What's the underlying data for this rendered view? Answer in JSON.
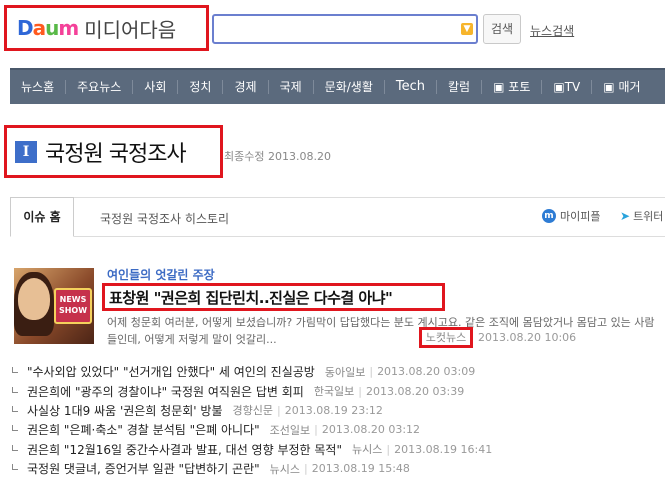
{
  "header": {
    "logo": {
      "d": "D",
      "a": "a",
      "u": "u",
      "m": "m",
      "media": "미디어다음"
    },
    "search": {
      "value": "",
      "placeholder": ""
    },
    "search_button": "검색",
    "news_search": "뉴스검색"
  },
  "nav": [
    "뉴스홈",
    "주요뉴스",
    "사회",
    "정치",
    "경제",
    "국제",
    "문화/생활",
    "Tech",
    "칼럼",
    "포토",
    "TV",
    "매거"
  ],
  "issue": {
    "icon": "I",
    "title": "국정원 국정조사",
    "meta": "최종수정 2013.08.20"
  },
  "tabs": {
    "active": "이슈 홈",
    "history": "국정원 국정조사 히스토리",
    "my_people": "마이피플",
    "twitter": "트위터"
  },
  "main_article": {
    "thumb_badge": "NEWS SHOW",
    "subheading": "여인들의 엇갈린 주장",
    "headline": "표창원 \"권은희 집단린치..진실은 다수결 아냐\"",
    "summary": "어제 청문회 여러분, 어떻게 보셨습니까? 가림막이 답답했다는 분도 계시고요. 같은 조직에 몸담았거나 몸담고 있는 사람들인데, 어떻게 저렇게 말이 엇갈리...",
    "source": "노컷뉴스",
    "date": "2013.08.20 10:06"
  },
  "related": [
    {
      "title": "\"수사외압 있었다\" \"선거개입 안했다\" 세 여인의 진실공방",
      "source": "동아일보",
      "date": "2013.08.20 03:09"
    },
    {
      "title": "권은희에 \"광주의 경찰이냐\" 국정원 여직원은 답변 회피",
      "source": "한국일보",
      "date": "2013.08.20 03:39"
    },
    {
      "title": "사실상 1대9 싸움 '권은희 청문회' 방불",
      "source": "경향신문",
      "date": "2013.08.19 23:12"
    },
    {
      "title": "권은희 \"은폐·축소\" 경찰 분석팀 \"은폐 아니다\"",
      "source": "조선일보",
      "date": "2013.08.20 03:12"
    },
    {
      "title": "권은희 \"12월16일 중간수사결과 발표, 대선 영향 부정한 목적\"",
      "source": "뉴시스",
      "date": "2013.08.19 16:41"
    },
    {
      "title": "국정원 댓글녀, 증언거부 일관 \"답변하기 곤란\"",
      "source": "뉴시스",
      "date": "2013.08.19 15:48"
    }
  ],
  "colors": {
    "highlight": "#e0161e",
    "nav_bg": "#5b6a7d",
    "link_blue": "#3c6bc4"
  }
}
